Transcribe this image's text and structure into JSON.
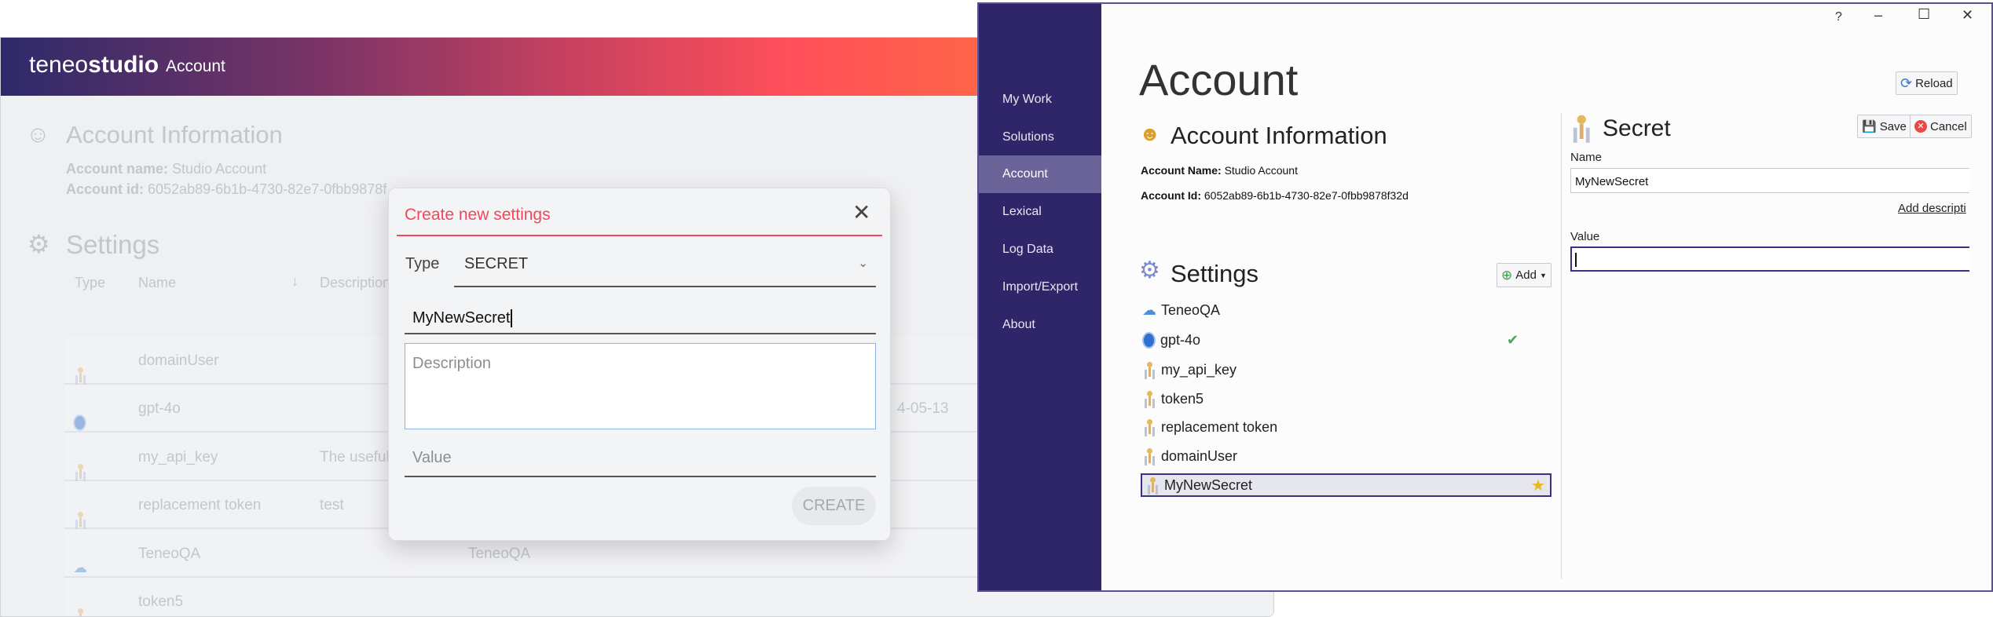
{
  "web": {
    "brand_light": "teneo",
    "brand_bold": "studio",
    "header_page": "Account",
    "account_info_title": "Account Information",
    "account_name_label": "Account name:",
    "account_name": "Studio Account",
    "account_id_label": "Account id:",
    "account_id": "6052ab89-6b1b-4730-82e7-0fbb9878f",
    "settings_title": "Settings",
    "columns": {
      "type": "Type",
      "name": "Name",
      "description": "Description"
    },
    "rows": [
      {
        "icon": "secret-key-icon",
        "name": "domainUser",
        "description": "",
        "date": ""
      },
      {
        "icon": "openai-icon",
        "name": "gpt-4o",
        "description": "",
        "date": "4-05-13"
      },
      {
        "icon": "secret-key-icon",
        "name": "my_api_key",
        "description": "The useful",
        "date": ""
      },
      {
        "icon": "secret-key-icon",
        "name": "replacement token",
        "description": "test",
        "date": ""
      },
      {
        "icon": "cloud-icon",
        "name": "TeneoQA",
        "description": "TeneoQA",
        "date": ""
      },
      {
        "icon": "secret-key-icon",
        "name": "token5",
        "description": "",
        "date": ""
      }
    ],
    "dialog": {
      "title": "Create new settings",
      "type_label": "Type",
      "type_value": "SECRET",
      "name_value": "MyNewSecret",
      "description_placeholder": "Description",
      "value_placeholder": "Value",
      "create_label": "CREATE"
    }
  },
  "desktop": {
    "window_controls": {
      "help": "?",
      "minimize": "–",
      "maximize": "☐",
      "close": "✕"
    },
    "sidebar": [
      {
        "label": "My Work"
      },
      {
        "label": "Solutions"
      },
      {
        "label": "Account",
        "active": true
      },
      {
        "label": "Lexical"
      },
      {
        "label": "Log Data"
      },
      {
        "label": "Import/Export"
      },
      {
        "label": "About"
      }
    ],
    "page_title": "Account",
    "reload_label": "Reload",
    "account_info_title": "Account Information",
    "account_name_label": "Account Name:",
    "account_name": "Studio Account",
    "account_id_label": "Account Id:",
    "account_id": "6052ab89-6b1b-4730-82e7-0fbb9878f32d",
    "settings_title": "Settings",
    "add_label": "Add",
    "settings": [
      {
        "icon": "cloud-icon",
        "name": "TeneoQA"
      },
      {
        "icon": "openai-icon",
        "name": "gpt-4o",
        "status": "check"
      },
      {
        "icon": "secret-key-icon",
        "name": "my_api_key"
      },
      {
        "icon": "secret-key-icon",
        "name": "token5"
      },
      {
        "icon": "secret-key-icon",
        "name": "replacement token"
      },
      {
        "icon": "secret-key-icon",
        "name": "domainUser"
      },
      {
        "icon": "secret-key-icon",
        "name": "MyNewSecret",
        "selected": true,
        "status": "star"
      }
    ],
    "secret": {
      "title": "Secret",
      "save_label": "Save",
      "cancel_label": "Cancel",
      "name_label": "Name",
      "name_value": "MyNewSecret",
      "add_description_link": "Add descripti",
      "value_label": "Value",
      "value_value": ""
    }
  },
  "colors": {
    "sidebar": "#2e2668",
    "sidebar_active": "#6b6498",
    "dialog_accent": "#f4465a"
  }
}
